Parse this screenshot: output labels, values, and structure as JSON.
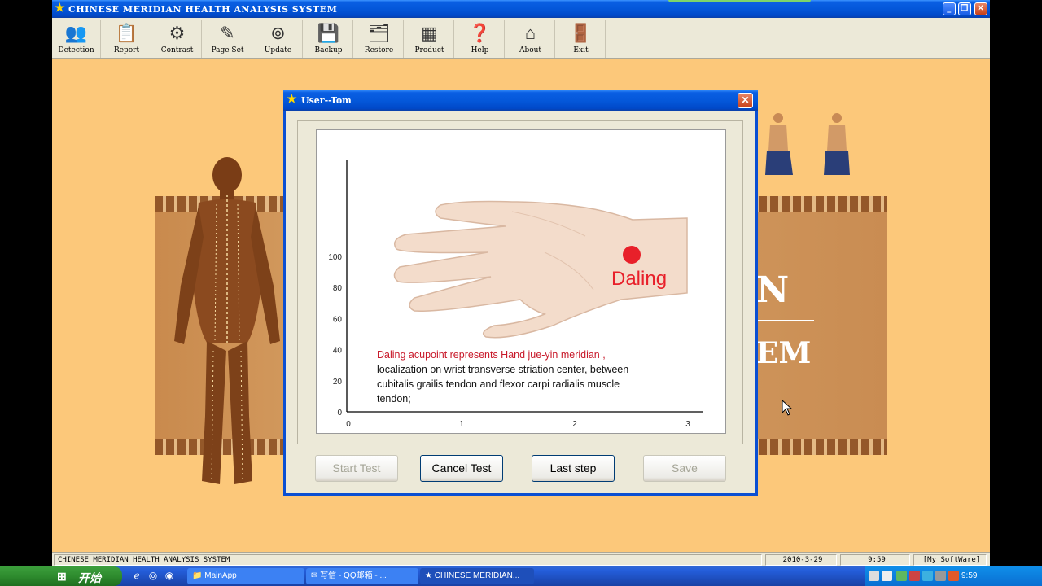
{
  "app": {
    "title": "CHINESE MERIDIAN HEALTH ANALYSIS SYSTEM",
    "window_controls": {
      "minimize": "_",
      "restore": "❐",
      "close": "✕"
    }
  },
  "toolbar": {
    "items": [
      {
        "label": "Detection",
        "icon": "people-icon"
      },
      {
        "label": "Report",
        "icon": "report-icon"
      },
      {
        "label": "Contrast",
        "icon": "contrast-icon"
      },
      {
        "label": "Page Set",
        "icon": "page-set-icon"
      },
      {
        "label": "Update",
        "icon": "update-icon"
      },
      {
        "label": "Backup",
        "icon": "backup-icon"
      },
      {
        "label": "Restore",
        "icon": "restore-icon"
      },
      {
        "label": "Product",
        "icon": "product-icon"
      },
      {
        "label": "Help",
        "icon": "help-icon"
      },
      {
        "label": "About",
        "icon": "home-icon"
      },
      {
        "label": "Exit",
        "icon": "exit-door-icon"
      }
    ]
  },
  "background": {
    "big_letter": "N",
    "big_suffix": "EM"
  },
  "dialog": {
    "title": "User--Tom",
    "close": "✕",
    "acupoint_label": "Daling",
    "description_highlight": "Daling acupoint represents Hand  jue-yin meridian ,",
    "description_lines": [
      "localization on wrist transverse striation center, between",
      "cubitalis grailis tendon and  flexor carpi radialis muscle",
      "tendon;"
    ],
    "buttons": {
      "start": "Start Test",
      "cancel": "Cancel Test",
      "last": "Last step",
      "save": "Save"
    }
  },
  "chart_data": {
    "type": "line",
    "x_ticks": [
      "0",
      "1",
      "2",
      "3"
    ],
    "y_ticks": [
      "0",
      "20",
      "40",
      "60",
      "80",
      "100"
    ],
    "xlim": [
      0,
      3
    ],
    "ylim": [
      0,
      100
    ],
    "series": []
  },
  "statusbar": {
    "app_name": "CHINESE MERIDIAN HEALTH ANALYSIS SYSTEM",
    "date": "2010-3-29",
    "time": "9:59",
    "software": "[My SoftWare]"
  },
  "taskbar": {
    "start_label": "开始",
    "tasks": [
      {
        "label": "MainApp",
        "icon": "folder-icon"
      },
      {
        "label": "写信 - QQ邮箱 - ...",
        "icon": "mail-icon"
      },
      {
        "label": "CHINESE MERIDIAN...",
        "icon": "star-icon"
      }
    ],
    "clock": "9:59"
  },
  "colors": {
    "accent_red": "#e8202a",
    "xp_blue": "#0457d9",
    "canvas_orange": "#fcc87a"
  }
}
